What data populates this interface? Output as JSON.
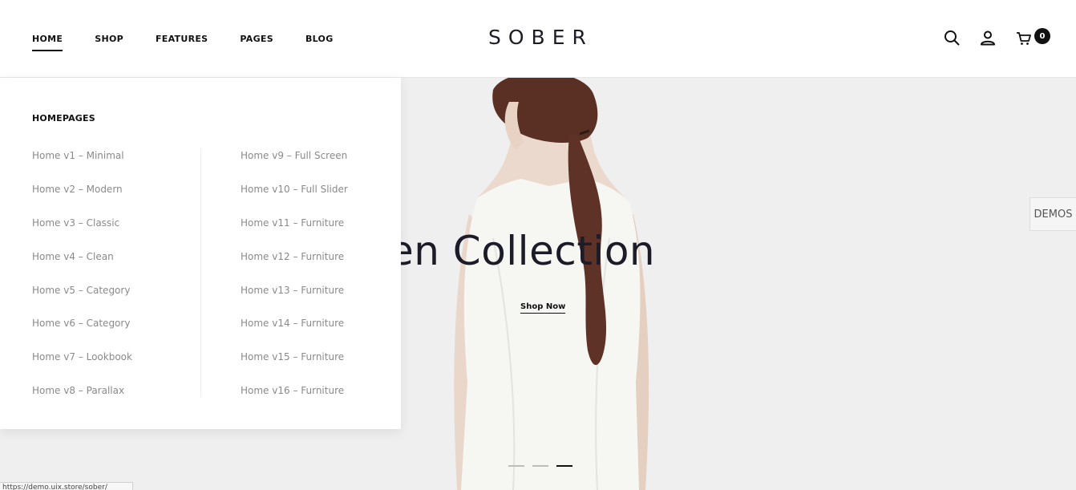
{
  "header": {
    "nav": [
      {
        "label": "HOME",
        "active": true
      },
      {
        "label": "SHOP"
      },
      {
        "label": "FEATURES"
      },
      {
        "label": "PAGES"
      },
      {
        "label": "BLOG"
      }
    ],
    "logo": "SOBER",
    "cart_count": "0",
    "icons": [
      "search-icon",
      "user-icon",
      "cart-icon"
    ]
  },
  "dropdown": {
    "heading": "HOMEPAGES",
    "col1": [
      "Home v1 – Minimal",
      "Home v2 – Modern",
      "Home v3 – Classic",
      "Home v4 – Clean",
      "Home v5 – Category",
      "Home v6 – Category",
      "Home v7 – Lookbook",
      "Home v8 – Parallax"
    ],
    "col2": [
      "Home v9 – Full Screen",
      "Home v10 – Full Slider",
      "Home v11 – Furniture",
      "Home v12 – Furniture",
      "Home v13 – Furniture",
      "Home v14 – Furniture",
      "Home v15 – Furniture",
      "Home v16 – Furniture"
    ]
  },
  "hero": {
    "title": "Linen Collection",
    "cta": "Shop Now",
    "slides": 3,
    "active_slide": 3
  },
  "demos_tab": "DEMOS",
  "status_url": "https://demo.uix.store/sober/",
  "colors": {
    "text_dark": "#1c1c28",
    "link_gray": "#8a8a8a",
    "hero_bg": "#efeff0"
  }
}
